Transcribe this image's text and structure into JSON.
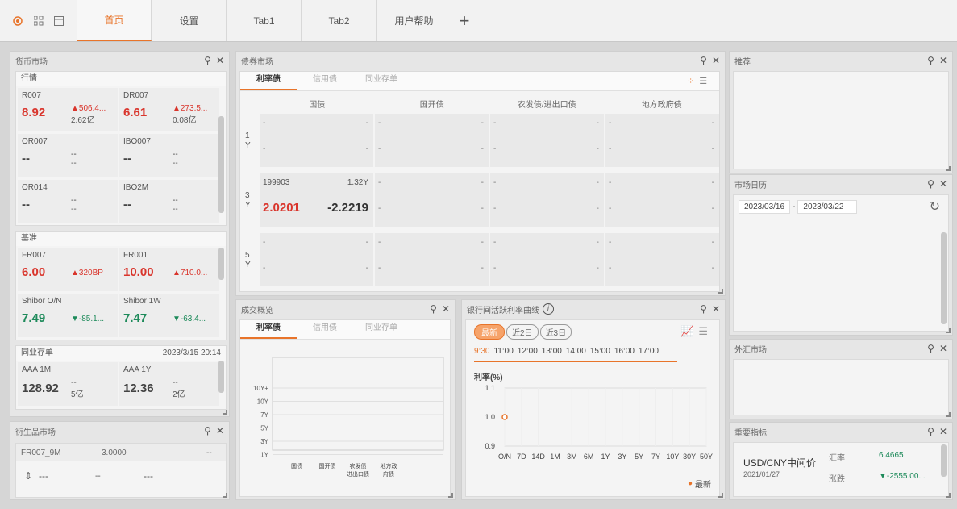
{
  "topbar": {
    "tabs": [
      {
        "label": "首页"
      },
      {
        "label": "设置"
      },
      {
        "label": "Tab1"
      },
      {
        "label": "Tab2"
      },
      {
        "label": "用户帮助"
      }
    ],
    "add": "+"
  },
  "money": {
    "title": "货币市场",
    "section1": "行情",
    "section2": "基准",
    "section3": "同业存单",
    "section3_time": "2023/3/15 20:14",
    "q": [
      {
        "name": "R007",
        "value": "8.92",
        "chg": "▲506.4...",
        "vol": "2.62亿",
        "color": "red"
      },
      {
        "name": "DR007",
        "value": "6.61",
        "chg": "▲273.5...",
        "vol": "0.08亿",
        "color": "red"
      },
      {
        "name": "OR007",
        "value": "--",
        "chg": "--",
        "vol": "--",
        "color": "none"
      },
      {
        "name": "IBO007",
        "value": "--",
        "chg": "--",
        "vol": "--",
        "color": "none"
      },
      {
        "name": "OR014",
        "value": "--",
        "chg": "--",
        "vol": "--",
        "color": "none"
      },
      {
        "name": "IBO2M",
        "value": "--",
        "chg": "--",
        "vol": "--",
        "color": "none"
      }
    ],
    "b": [
      {
        "name": "FR007",
        "value": "6.00",
        "chg": "▲320BP",
        "color": "red"
      },
      {
        "name": "FR001",
        "value": "10.00",
        "chg": "▲710.0...",
        "color": "red"
      },
      {
        "name": "Shibor O/N",
        "value": "7.49",
        "chg": "▼-85.1...",
        "color": "green"
      },
      {
        "name": "Shibor 1W",
        "value": "7.47",
        "chg": "▼-63.4...",
        "color": "green"
      }
    ],
    "c": [
      {
        "name": "AAA 1M",
        "value": "128.92",
        "chg": "--",
        "vol": "5亿"
      },
      {
        "name": "AAA 1Y",
        "value": "12.36",
        "chg": "--",
        "vol": "2亿"
      }
    ]
  },
  "deriv": {
    "title": "衍生品市场",
    "name": "FR007_9M",
    "value": "3.0000",
    "dash": "--",
    "a": "---",
    "b": "--",
    "c": "---"
  },
  "bond": {
    "title": "债券市场",
    "tabs": [
      "利率债",
      "信用债",
      "同业存单"
    ],
    "cols": [
      "国债",
      "国开债",
      "农发债/进出口债",
      "地方政府债"
    ],
    "rows": [
      {
        "label": "1Y"
      },
      {
        "label": "3Y",
        "code": "199903",
        "term": "1.32Y",
        "v1": "2.0201",
        "v2": "-2.2219"
      },
      {
        "label": "5Y"
      }
    ],
    "dash": "-"
  },
  "trade": {
    "title": "成交概览",
    "tabs": [
      "利率债",
      "信用债",
      "同业存单"
    ],
    "yticks": [
      "10Y+",
      "10Y",
      "7Y",
      "5Y",
      "3Y",
      "1Y"
    ],
    "xcats": [
      "国债",
      "国开债",
      "农发债\n进出口债",
      "地方政\n府债"
    ]
  },
  "curve": {
    "title": "银行间活跃利率曲线",
    "btns": [
      "最新",
      "近2日",
      "近3日"
    ],
    "times": [
      "9:30",
      "11:00",
      "12:00",
      "13:00",
      "14:00",
      "15:00",
      "16:00",
      "17:00"
    ],
    "ylabel": "利率(%)",
    "chart_data": {
      "type": "scatter",
      "x": [
        "O/N",
        "7D",
        "14D",
        "1M",
        "3M",
        "6M",
        "1Y",
        "3Y",
        "5Y",
        "7Y",
        "10Y",
        "30Y",
        "50Y"
      ],
      "yticks": [
        "1.1",
        "1.0",
        "0.9"
      ],
      "ylim": [
        0.9,
        1.1
      ],
      "series": [
        {
          "name": "最新",
          "points": [
            {
              "x": "O/N",
              "y": 1.0
            }
          ]
        }
      ]
    },
    "legend": "最新"
  },
  "recommend": {
    "title": "推荐"
  },
  "calendar": {
    "title": "市场日历",
    "from": "2023/03/16",
    "sep": "-",
    "to": "2023/03/22"
  },
  "fx": {
    "title": "外汇市场"
  },
  "key": {
    "title": "重要指标",
    "name": "USD/CNY中间价",
    "date": "2021/01/27",
    "l1": "汇率",
    "v1": "6.4665",
    "l2": "涨跌",
    "v2": "▼-2555.00..."
  },
  "colors": {
    "accent": "#e8742a",
    "red": "#d9352c",
    "green": "#1d8a5a"
  }
}
